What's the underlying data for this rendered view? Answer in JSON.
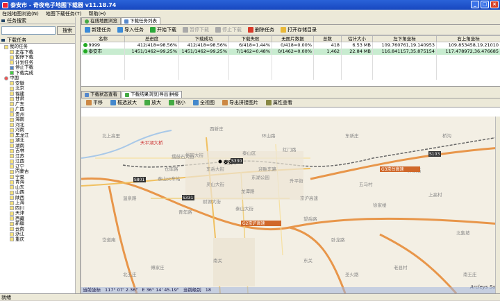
{
  "window": {
    "title": "泰安市 - 奇夜电子地图下载器 v11.18.74"
  },
  "menu": [
    "在线地图浏览(N)",
    "地图下载任务(T)",
    "帮助(H)"
  ],
  "sidebar": {
    "header": "任务搜索",
    "search_button": "搜索",
    "task_header": "下载任务",
    "tasks": [
      "我的任务",
      "正在下载",
      "暂停下载",
      "计划任务",
      "停止下载",
      "下载完成"
    ],
    "region_root": "中国",
    "regions": [
      "安徽",
      "北京",
      "福建",
      "甘肃",
      "广东",
      "广西",
      "贵州",
      "海南",
      "河北",
      "河南",
      "黑龙江",
      "湖北",
      "湖南",
      "吉林",
      "江苏",
      "江西",
      "辽宁",
      "内蒙古",
      "宁夏",
      "青海",
      "山东",
      "山西",
      "陕西",
      "上海",
      "四川",
      "天津",
      "西藏",
      "新疆",
      "云南",
      "浙江",
      "重庆"
    ]
  },
  "tabs": [
    "在线地图浏览",
    "下载任务列表"
  ],
  "toolbar": [
    {
      "label": "新建任务",
      "enabled": true,
      "color": "#3a8ad8"
    },
    {
      "label": "导入任务",
      "enabled": true,
      "color": "#3a8ad8"
    },
    {
      "label": "开始下载",
      "enabled": true,
      "color": "#2aa83a"
    },
    {
      "label": "暂停下载",
      "enabled": false,
      "color": "#aaaaaa"
    },
    {
      "label": "停止下载",
      "enabled": false,
      "color": "#aaaaaa"
    },
    {
      "label": "删除任务",
      "enabled": true,
      "color": "#d83a2a"
    },
    {
      "label": "打开存储目录",
      "enabled": true,
      "color": "#e8b838"
    }
  ],
  "table": {
    "columns": [
      "名称",
      "总进度",
      "下载成功",
      "下载失败",
      "无图片数据",
      "总数",
      "估计大小",
      "左下角坐标",
      "右上角坐标"
    ],
    "rows": [
      [
        "9999",
        "412/418=98.56%",
        "412/418=98.56%",
        "6/418=1.44%",
        "0/418=0.00%",
        "418",
        "6.53 MB",
        "109.760761,19.140953",
        "109.853458,19.21010"
      ],
      [
        "泰安市",
        "1451/1462=99.25%",
        "1451/1462=99.25%",
        "7/1462=0.48%",
        "0/1462=0.00%",
        "1,462",
        "22.84 MB",
        "116.841157,35.875154",
        "117.478972,36.476685"
      ]
    ]
  },
  "subtabs": [
    "下载状态查看",
    "下载结果浏览|导出|拼接"
  ],
  "map_toolbar": [
    "平移",
    "框选放大",
    "放大",
    "缩小",
    "全视图",
    "导出拼接图片",
    "属性查看"
  ],
  "map": {
    "labels": [
      "泰安市",
      "东岳大街",
      "泰山区",
      "迎胜东路",
      "东湖公园",
      "岱宗大街",
      "天平湖大桥",
      "灵山大街",
      "泰山大街",
      "财源大街",
      "京沪高速",
      "泰山火车站",
      "升平街",
      "龙潭路",
      "擂鼓石大街",
      "仓库路",
      "南关",
      "北上高里",
      "西新庄",
      "东新庄",
      "邱家店",
      "温泉路",
      "环山路",
      "红门路",
      "青年路",
      "望岳路",
      "卧龙路",
      "五马村",
      "徐家楼",
      "上高村",
      "北集坡",
      "东关",
      "岱道庵",
      "傅家庄",
      "老县村",
      "桥沟",
      "圣火路",
      "北王庄",
      "南王庄"
    ],
    "roads": [
      "G3京台高速",
      "G2京沪高速",
      "S330",
      "S331",
      "S801",
      "S103"
    ],
    "status": {
      "coord_label": "当前坐标",
      "lon": "117° 07' 2.36\"",
      "lat": "E 36° 14' 45.19\"",
      "level_label": "当前级别",
      "level": "18"
    },
    "watermark": "Arcleys Software"
  },
  "status": "就绪"
}
